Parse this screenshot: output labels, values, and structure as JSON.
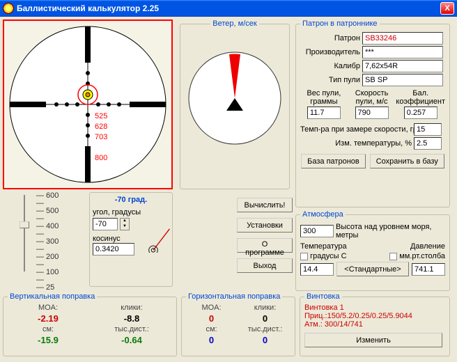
{
  "window": {
    "title": "Баллистический калькулятор 2.25",
    "close": "X"
  },
  "wind": {
    "legend": "Ветер, м/сек"
  },
  "cartridge": {
    "legend": "Патрон в патроннике",
    "labels": {
      "patron": "Патрон",
      "mfr": "Производитель",
      "cal": "Калибр",
      "type": "Тип пули"
    },
    "patron": "SB33246",
    "mfr": "***",
    "cal": "7,62x54R",
    "type": "SB SP",
    "col_labels": {
      "wt": "Вес пули, граммы",
      "spd": "Скорость пули, м/с",
      "bc": "Бал. коэффициент"
    },
    "wt": "11.7",
    "spd": "790",
    "bc": "0.257",
    "temp_lbl": "Темп-ра при замере скорости, гр.",
    "temp": "15",
    "dt_lbl": "Изм. температуры, %",
    "dt": "2.5",
    "db_btn": "База патронов",
    "save_btn": "Сохранить в базу"
  },
  "scope": {
    "marks": [
      "525",
      "628",
      "703",
      "800"
    ]
  },
  "slider": {
    "ticks": [
      "600",
      "500",
      "400",
      "300",
      "200",
      "100",
      "25"
    ]
  },
  "angle": {
    "title": "-70 град.",
    "deg_lbl": "угол, градусы",
    "deg": "-70",
    "cos_lbl": "косинус",
    "cos": "0.3420"
  },
  "buttons": {
    "calc": "Вычислить!",
    "settings": "Установки",
    "about": "О программе",
    "exit": "Выход"
  },
  "atmo": {
    "legend": "Атмосфера",
    "alt": "300",
    "alt_lbl": "Высота над уровнем моря, метры",
    "tcol": "Температура",
    "pcol": "Давление",
    "tcheck": "градусы С",
    "pcheck": "мм.рт.столба",
    "t": "14.4",
    "std": "<Стандартные>",
    "p": "741.1"
  },
  "vert": {
    "legend": "Вертикальная поправка",
    "moa_l": "MOA:",
    "clk_l": "клики:",
    "cm_l": "см:",
    "td_l": "тыс.дист.:",
    "moa": "-2.19",
    "clk": "-8.8",
    "cm": "-15.9",
    "td": "-0.64"
  },
  "horz": {
    "legend": "Горизонтальная поправка",
    "moa_l": "MOA:",
    "clk_l": "клики:",
    "cm_l": "см:",
    "td_l": "тыс.дист.:",
    "moa": "0",
    "clk": "0",
    "cm": "0",
    "td": "0"
  },
  "rifle": {
    "legend": "Винтовка",
    "name": "Винтовка 1",
    "scope": "Приц.:150/5.2/0.25/0.25/5.9044",
    "atm": "Атм.:  300/14/741",
    "edit": "Изменить"
  }
}
